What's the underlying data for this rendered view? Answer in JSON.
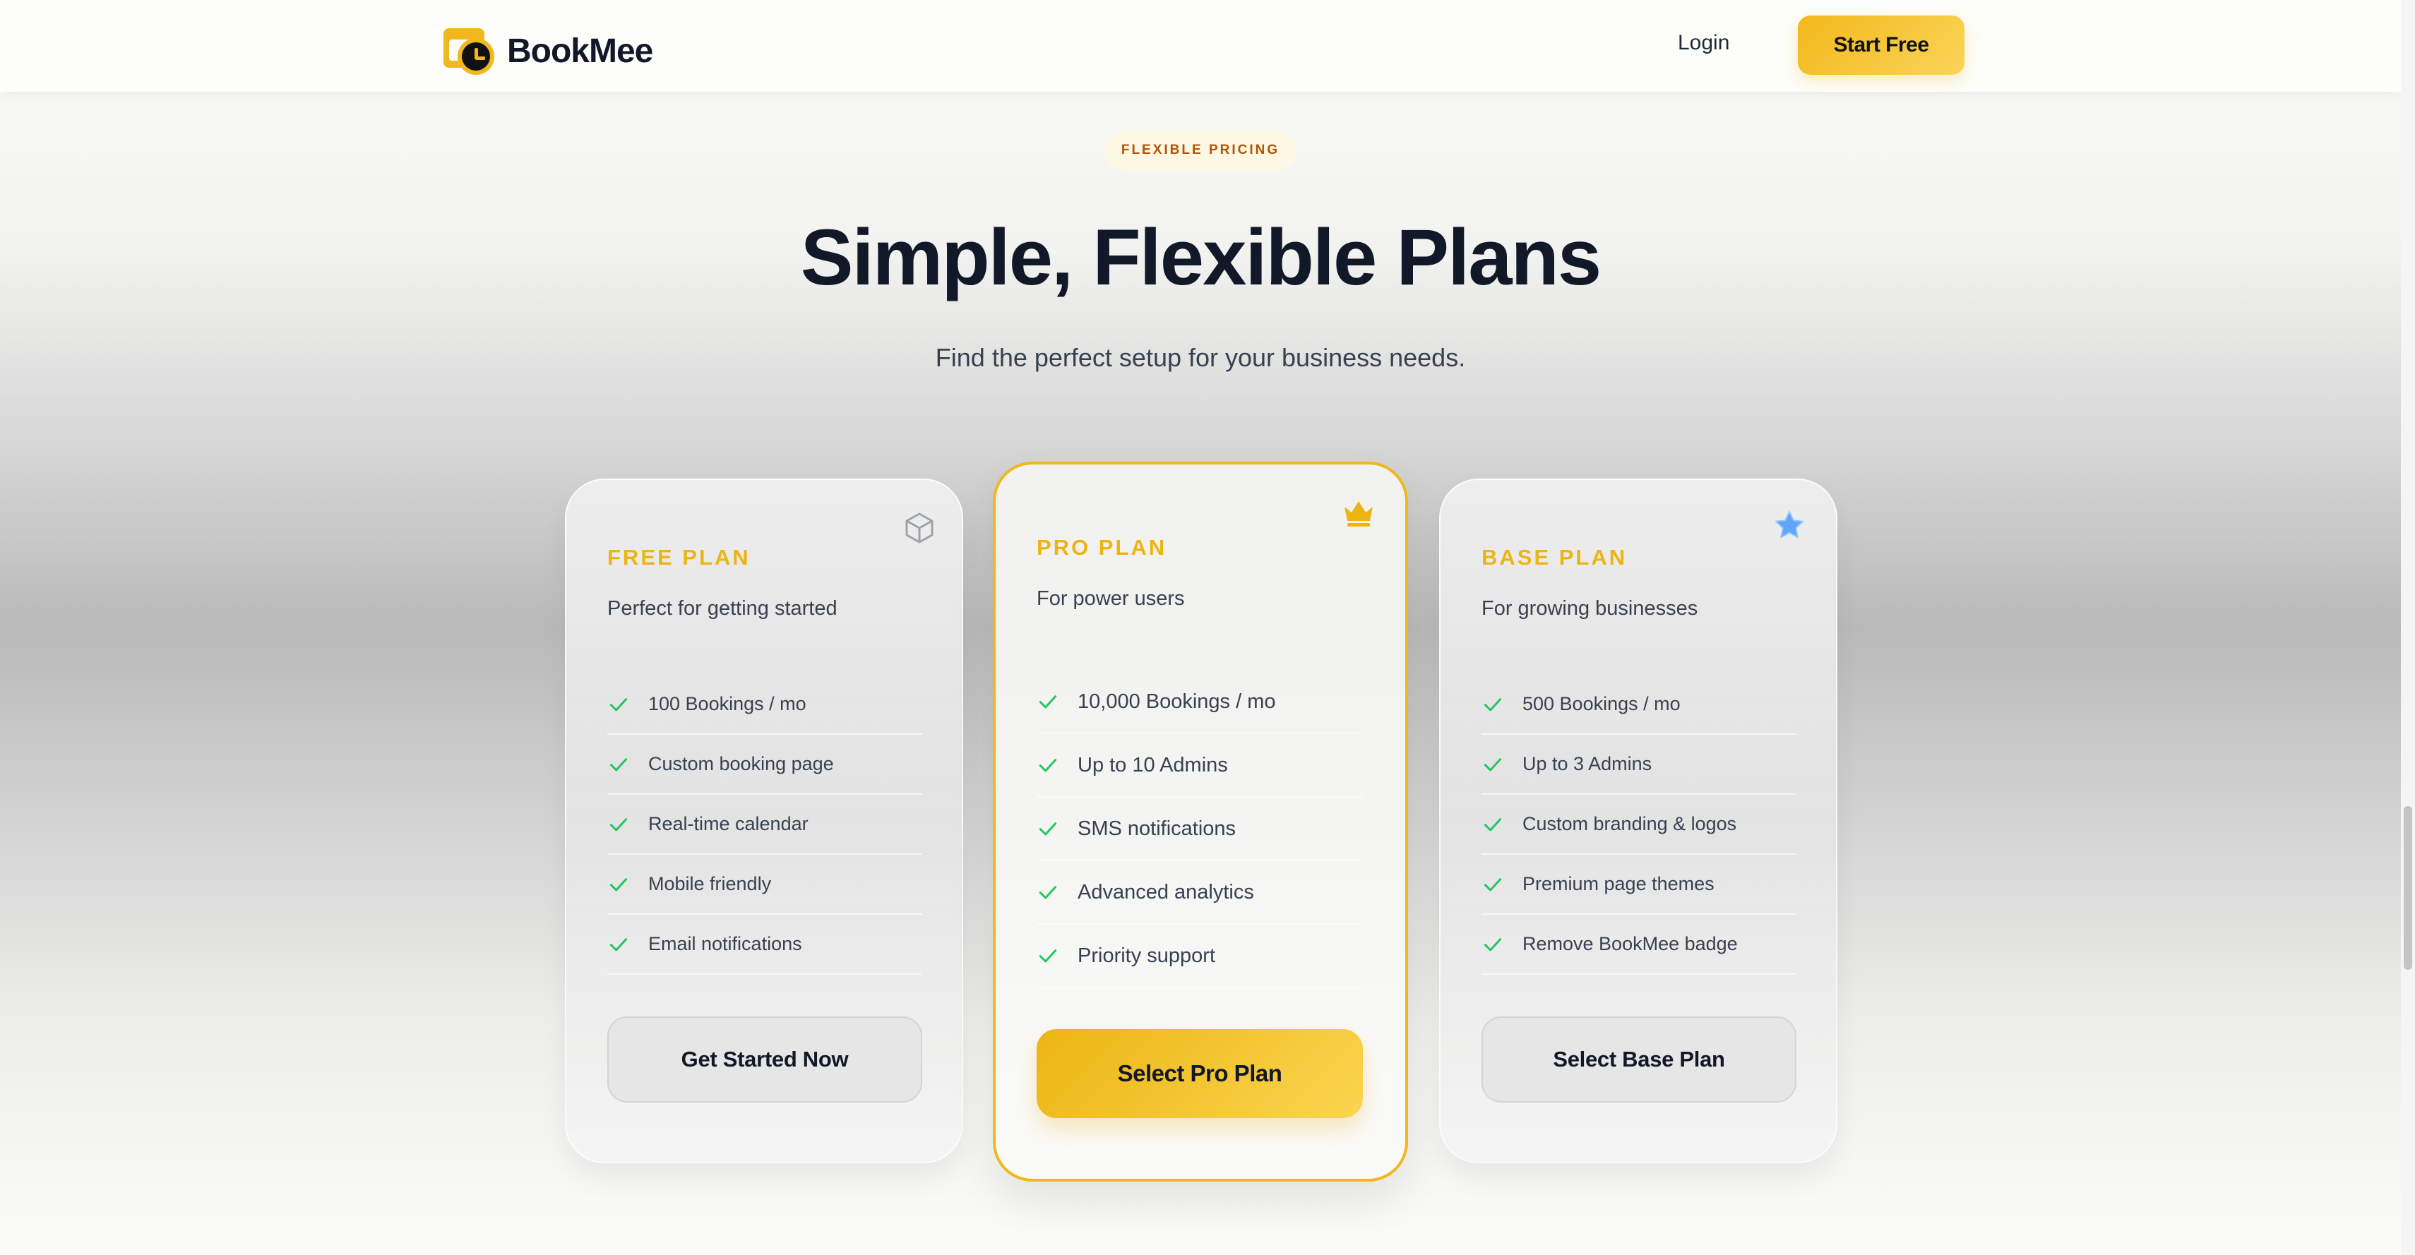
{
  "brand": {
    "name": "BookMee",
    "accent": "#f0b81c"
  },
  "header": {
    "login_label": "Login",
    "cta_label": "Start Free"
  },
  "hero": {
    "badge": "FLEXIBLE PRICING",
    "title": "Simple, Flexible Plans",
    "subtitle": "Find the perfect setup for your business needs."
  },
  "plans": [
    {
      "name": "FREE PLAN",
      "description": "Perfect for getting started",
      "icon": "box-icon",
      "features": [
        "100 Bookings / mo",
        "Custom booking page",
        "Real-time calendar",
        "Mobile friendly",
        "Email notifications"
      ],
      "button": "Get Started Now"
    },
    {
      "name": "PRO PLAN",
      "description": "For power users",
      "icon": "crown-icon",
      "features": [
        "10,000 Bookings / mo",
        "Up to 10 Admins",
        "SMS notifications",
        "Advanced analytics",
        "Priority support"
      ],
      "button": "Select Pro Plan"
    },
    {
      "name": "BASE PLAN",
      "description": "For growing businesses",
      "icon": "star-icon",
      "features": [
        "500 Bookings / mo",
        "Up to 3 Admins",
        "Custom branding & logos",
        "Premium page themes",
        "Remove BookMee badge"
      ],
      "button": "Select Base Plan"
    }
  ],
  "colors": {
    "check": "#22c55e",
    "plan_name": "#ecb513",
    "star": "#60a5fa"
  }
}
